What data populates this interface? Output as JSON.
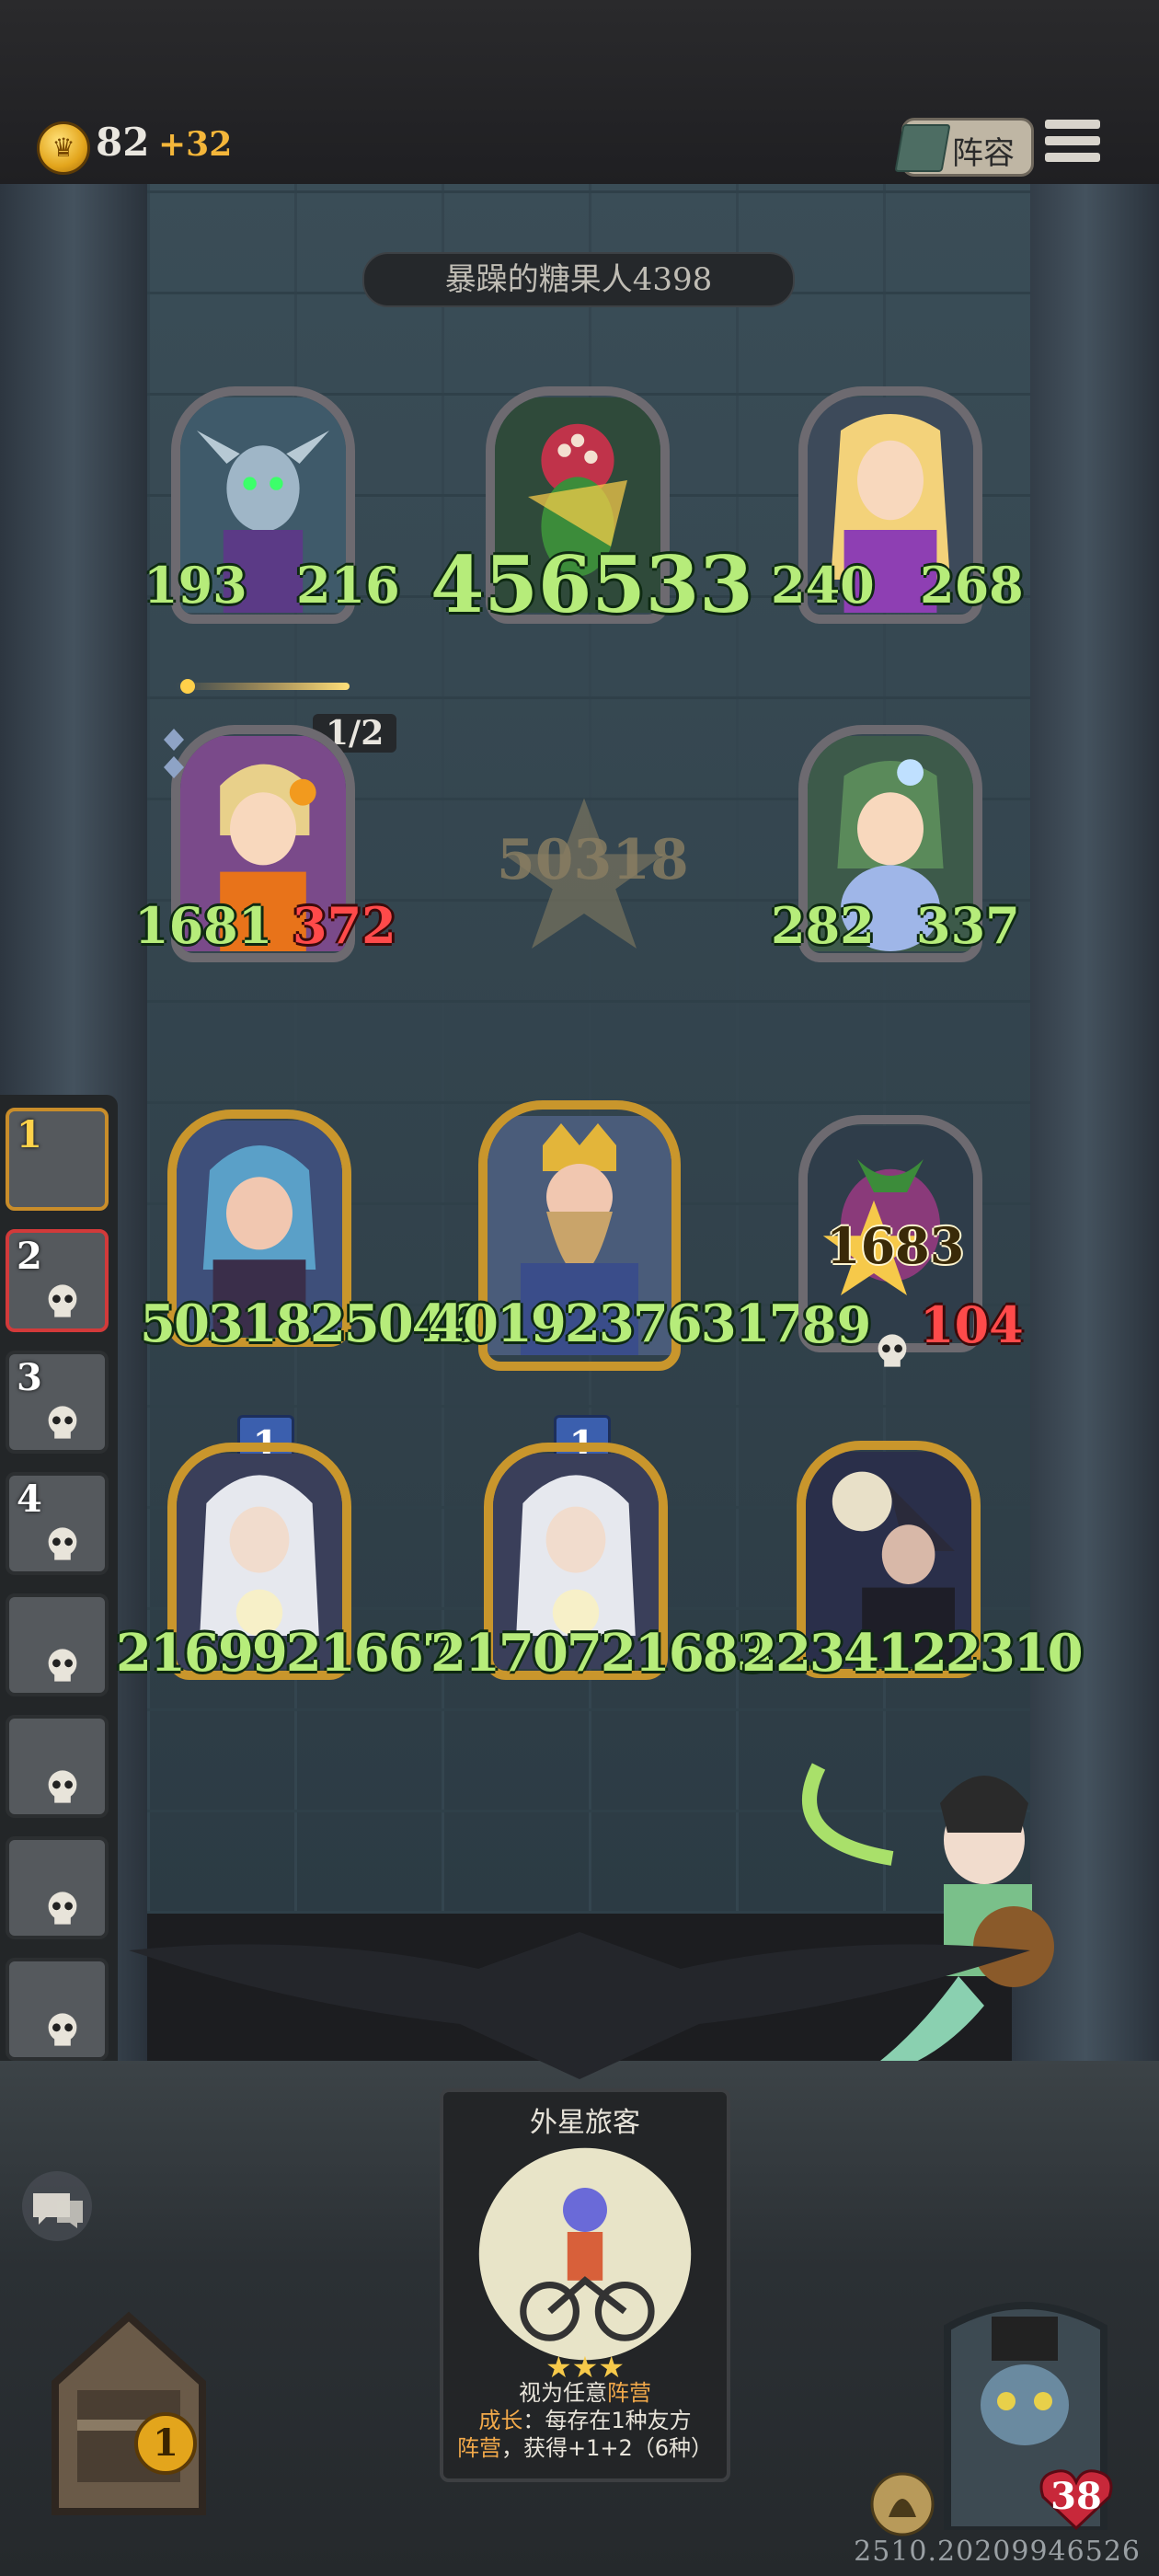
{
  "top_bar": {
    "gold": "82",
    "gold_bonus": "+32",
    "roster_label": "阵容"
  },
  "enemy": {
    "name": "暴躁的糖果人4398"
  },
  "board": {
    "center_value": "50318",
    "ammo": "1/2",
    "enemy_row_1": [
      {
        "left": "193",
        "right": "216"
      },
      {
        "big": "456533"
      },
      {
        "left": "240",
        "right": "268"
      }
    ],
    "enemy_row_2": [
      {
        "left": "1681",
        "right": "372",
        "right_color": "red"
      },
      {
        "left": "282",
        "right": "337"
      }
    ],
    "player_row_1": [
      {
        "text": "50318250462"
      },
      {
        "text": "40192376317"
      },
      {
        "left": "89",
        "right": "104",
        "right_color": "red",
        "float": "1683"
      }
    ],
    "player_row_2": [
      {
        "badge": "1",
        "text": "2169921667"
      },
      {
        "badge": "1",
        "text": "2170721683"
      },
      {
        "text": "2234122310"
      }
    ]
  },
  "queue": [
    {
      "num": "1"
    },
    {
      "num": "2"
    },
    {
      "num": "3"
    },
    {
      "num": "4"
    },
    {},
    {},
    {},
    {}
  ],
  "offer": {
    "title": "外星旅客",
    "stars": "★★★",
    "line1_pre": "视为任意",
    "line1_hl": "阵营",
    "line2_hl": "成长",
    "line2_rest": "：每存在1种友方",
    "line3_hl": "阵营",
    "line3_rest": "，获得+1+2（6种）"
  },
  "bottom": {
    "chest_count": "1",
    "hp": "38",
    "version": "2510.20209946526"
  },
  "colors": {
    "stat_green": "#b6ec7a",
    "stat_red": "#ff4a4a",
    "gold": "#e3a51c",
    "board": "#34454f"
  },
  "icons": [
    "coin-icon",
    "book-icon",
    "menu-icon",
    "skull-icon",
    "chat-icon",
    "chest-icon",
    "helmet-icon",
    "heart-icon",
    "star-icon"
  ]
}
